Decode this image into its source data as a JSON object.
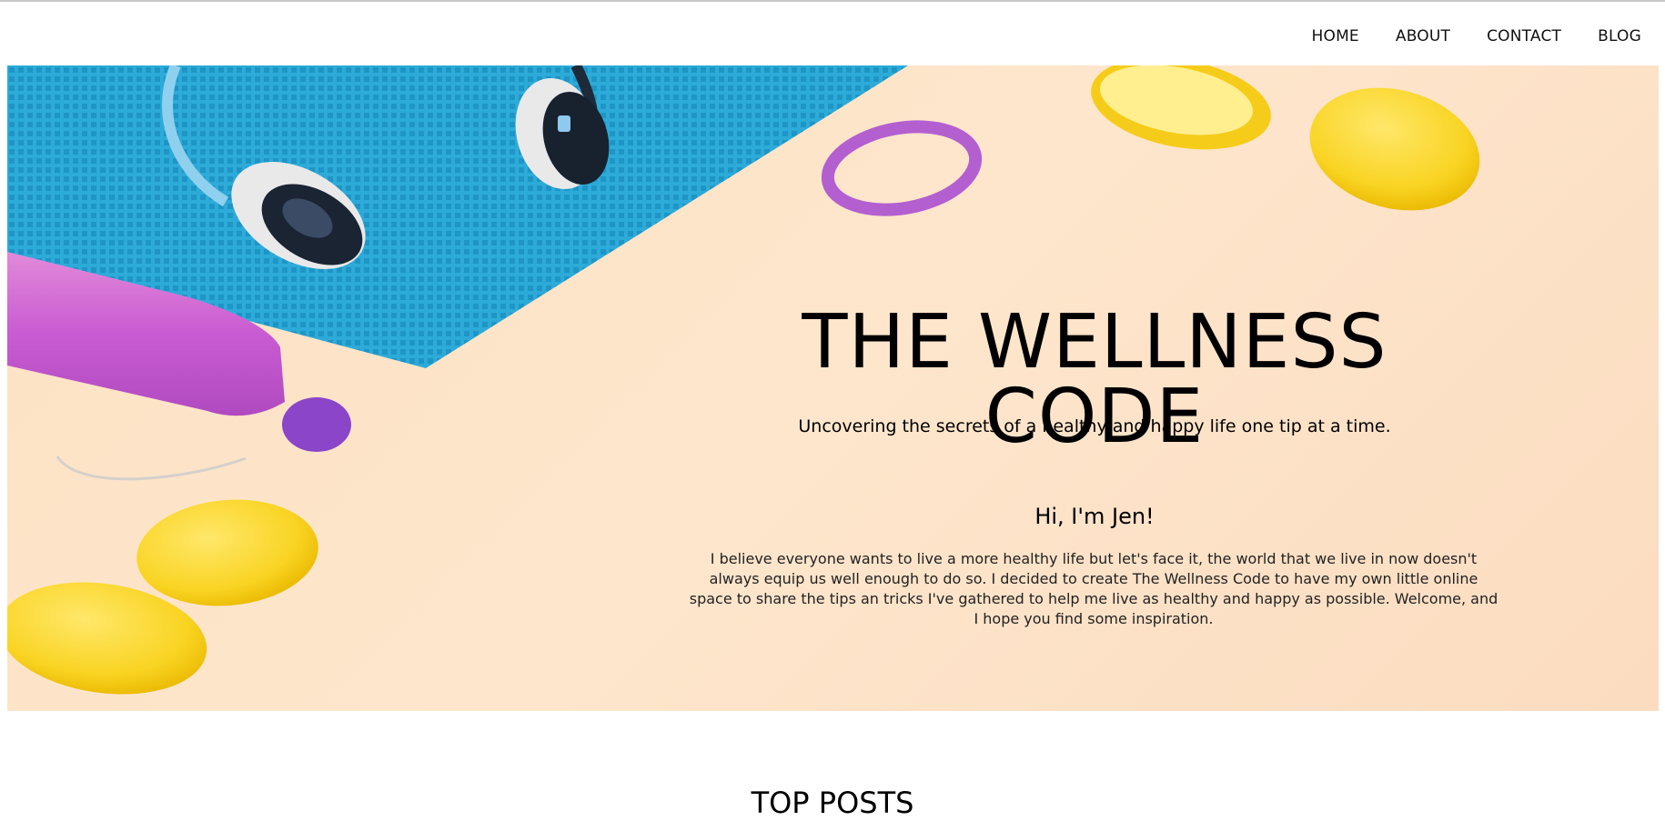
{
  "nav": {
    "items": [
      {
        "label": "HOME"
      },
      {
        "label": "ABOUT"
      },
      {
        "label": "CONTACT"
      },
      {
        "label": "BLOG"
      }
    ]
  },
  "hero": {
    "title": "THE WELLNESS CODE",
    "tagline": "Uncovering the secrets of a healthy and happy life one tip at a time.",
    "intro_heading": "Hi, I'm Jen!",
    "intro_body": "I believe everyone wants to live a more healthy life but let's face it, the world that we live in now doesn't always equip us well enough to do so. I decided to create The Wellness Code to have my own little online space to share the tips an tricks I've gathered to help me live as healthy and happy as possible. Welcome, and I hope you find some inspiration.",
    "background_color": "#fde2c4"
  },
  "top_posts": {
    "heading": "TOP POSTS"
  },
  "colors": {
    "mat": "#29a9d9",
    "lemon": "#f9d423",
    "bottle": "#c95bd2",
    "band": "#b05fce"
  }
}
